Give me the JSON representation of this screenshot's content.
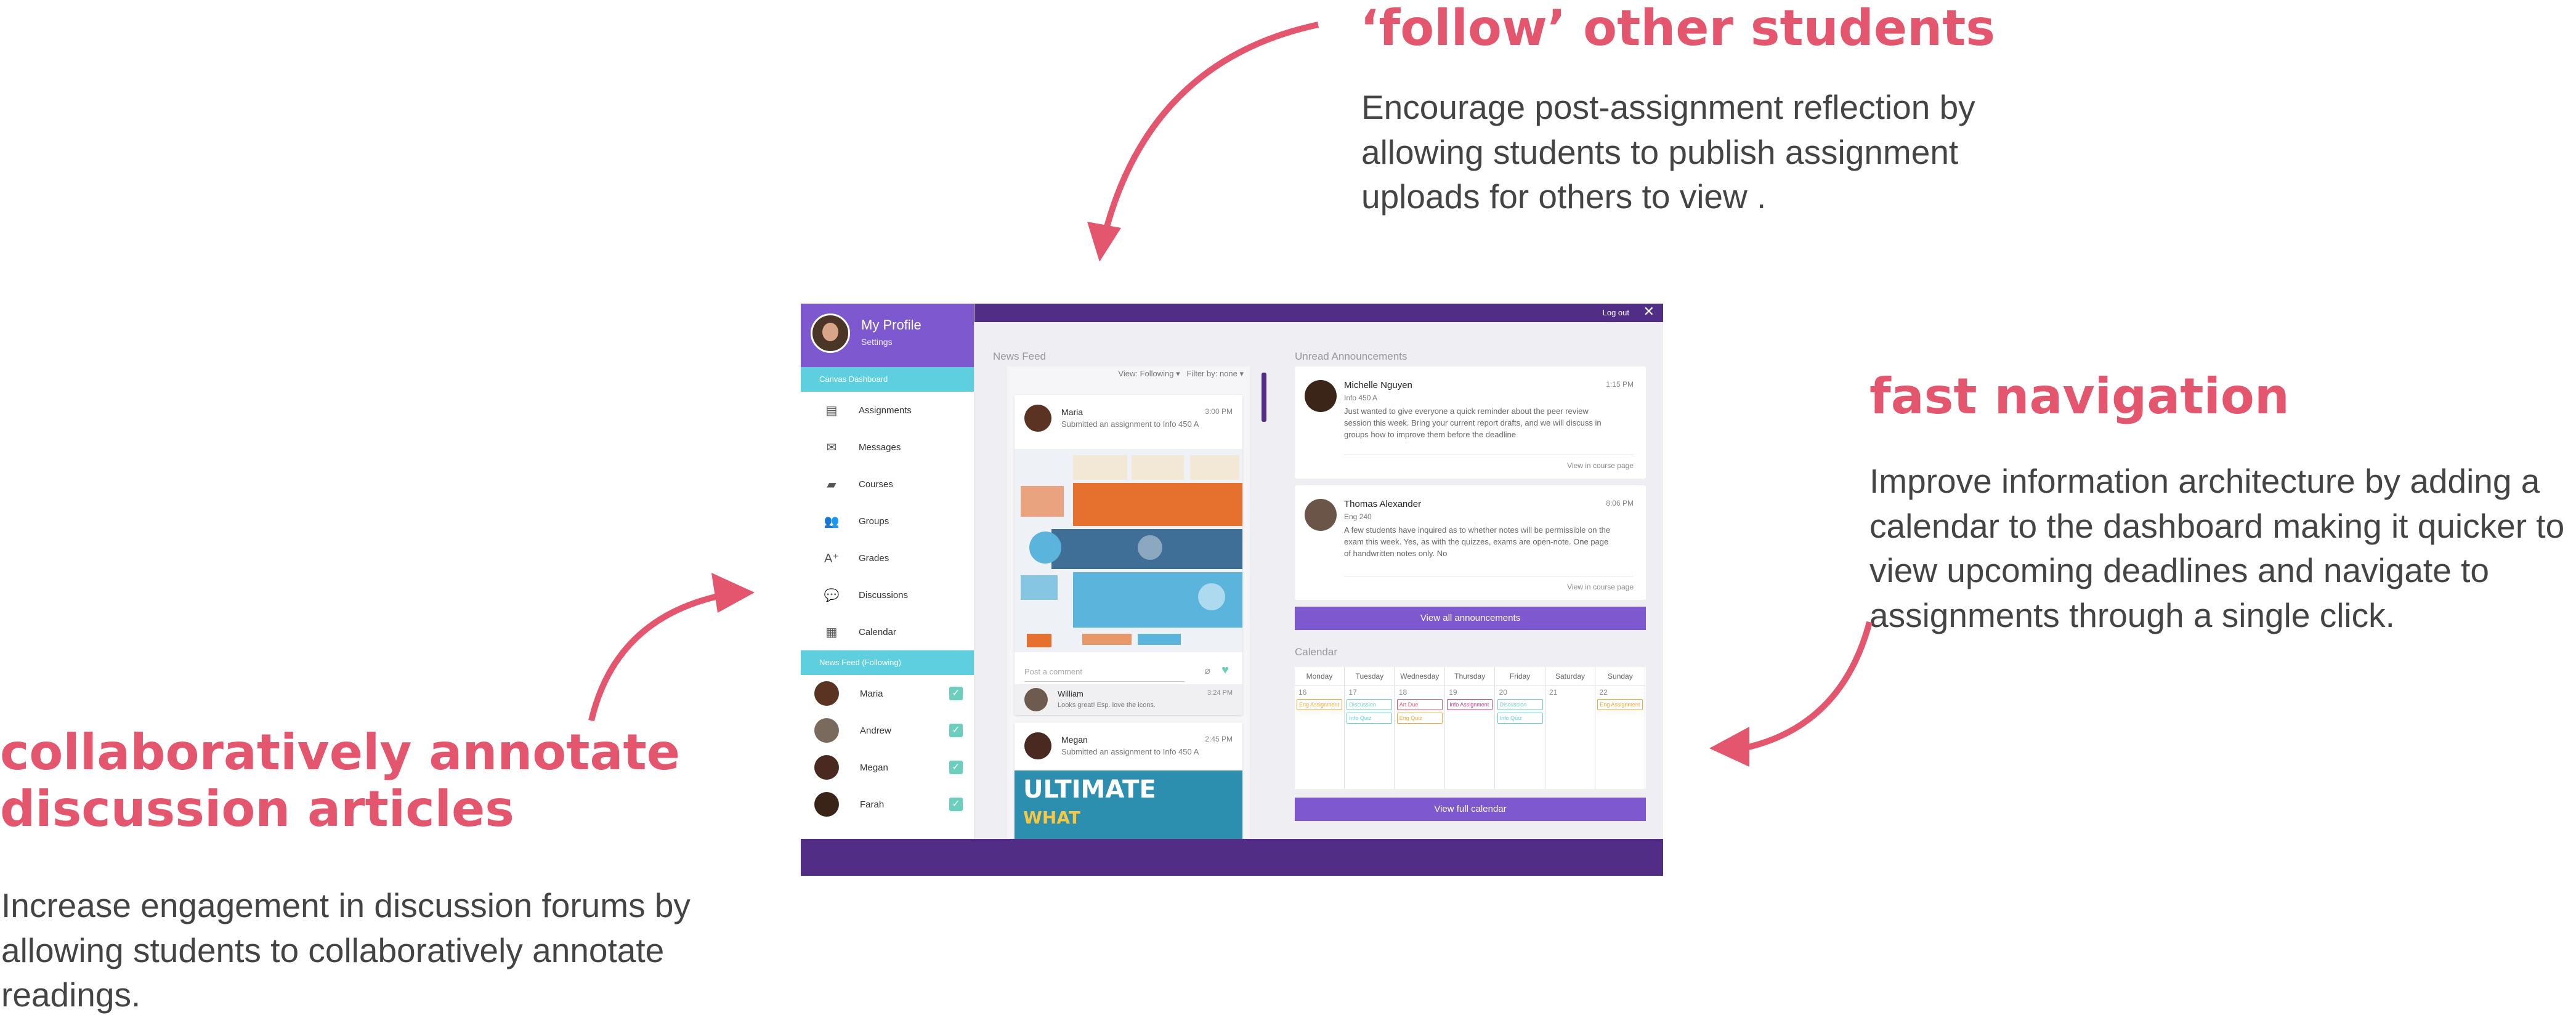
{
  "annotations": {
    "follow": {
      "title": "‘follow’ other students",
      "body": "Encourage post-assignment reflection by allowing students to publish assignment uploads for others to view ."
    },
    "navigation": {
      "title": "fast navigation",
      "body": "Improve information architecture by adding a calendar to the dashboard making it quicker to view upcoming deadlines and navigate to assignments through a single click."
    },
    "collaborate": {
      "title": "collaboratively annotate discussion articles",
      "body": "Increase engagement in discussion forums by allowing students to collaboratively annotate readings."
    }
  },
  "colors": {
    "accent": "#e4566e",
    "purple_dark": "#512d86",
    "purple": "#7d58cf",
    "teal": "#5dcfdf"
  },
  "topbar": {
    "logout": "Log out",
    "close_icon": "close-icon"
  },
  "profile": {
    "name": "My Profile",
    "settings": "Settings"
  },
  "sidebar": {
    "section_label": "Canvas Dashboard",
    "items": [
      {
        "label": "Assignments",
        "icon": "document-icon",
        "glyph": "▤"
      },
      {
        "label": "Messages",
        "icon": "mail-icon",
        "glyph": "✉"
      },
      {
        "label": "Courses",
        "icon": "folder-icon",
        "glyph": "▰"
      },
      {
        "label": "Groups",
        "icon": "people-icon",
        "glyph": "👥"
      },
      {
        "label": "Grades",
        "icon": "grade-icon",
        "glyph": "A⁺"
      },
      {
        "label": "Discussions",
        "icon": "chat-icon",
        "glyph": "💬"
      },
      {
        "label": "Calendar",
        "icon": "calendar-icon",
        "glyph": "▦"
      }
    ],
    "following_label": "News Feed (Following)",
    "following": [
      {
        "name": "Maria",
        "checked": true,
        "color": "#5a3322"
      },
      {
        "name": "Andrew",
        "checked": true,
        "color": "#7a6a5e"
      },
      {
        "name": "Megan",
        "checked": true,
        "color": "#4a2a20"
      },
      {
        "name": "Farah",
        "checked": true,
        "color": "#3a2418"
      }
    ]
  },
  "news_feed": {
    "title": "News Feed",
    "view": "View: Following",
    "filter": "Filter by: none",
    "posts": [
      {
        "name": "Maria",
        "time": "3:00 PM",
        "text": "Submitted an assignment to Info 450 A",
        "comment_placeholder": "Post a comment",
        "comment": {
          "name": "William",
          "text": "Looks great! Esp. love the icons.",
          "time": "3:24 PM"
        }
      },
      {
        "name": "Megan",
        "time": "2:45 PM",
        "text": "Submitted an assignment to Info 450 A",
        "image_text": [
          "ULTIMATE",
          "WHAT"
        ]
      }
    ]
  },
  "announcements": {
    "title": "Unread Announcements",
    "items": [
      {
        "name": "Michelle Nguyen",
        "course": "Info 450 A",
        "time": "1:15 PM",
        "text": "Just wanted to give everyone a quick reminder about the peer review session this week. Bring your current report drafts, and we will discuss in groups how to improve them before the deadline",
        "link": "View in course page"
      },
      {
        "name": "Thomas Alexander",
        "course": "Eng 240",
        "time": "8:06 PM",
        "text": "A few students have inquired as to whether notes will be permissible on the exam this week. Yes, as with the quizzes, exams are open-note. One page of handwritten notes only. No",
        "link": "View in course page"
      }
    ],
    "view_all": "View all announcements"
  },
  "calendar": {
    "title": "Calendar",
    "days": [
      "Monday",
      "Tuesday",
      "Wednesday",
      "Thursday",
      "Friday",
      "Saturday",
      "Sunday"
    ],
    "dates": [
      "16",
      "17",
      "18",
      "19",
      "20",
      "21",
      "22"
    ],
    "events": [
      [
        {
          "label": "Eng Assignment",
          "color": "#f0a830"
        }
      ],
      [
        {
          "label": "Discussion",
          "color": "#6ccfbd"
        },
        {
          "label": "Info Quiz",
          "color": "#5dcfdf"
        }
      ],
      [
        {
          "label": "Art Due",
          "color": "#e4566e"
        },
        {
          "label": "Eng Quiz",
          "color": "#f0a830"
        }
      ],
      [
        {
          "label": "Info Assignment",
          "color": "#c2418f"
        }
      ],
      [
        {
          "label": "Discussion",
          "color": "#6ccfbd"
        },
        {
          "label": "Info Quiz",
          "color": "#5dcfdf"
        }
      ],
      [],
      [
        {
          "label": "Eng Assignment",
          "color": "#f0a830"
        }
      ]
    ],
    "view_full": "View full calendar"
  }
}
